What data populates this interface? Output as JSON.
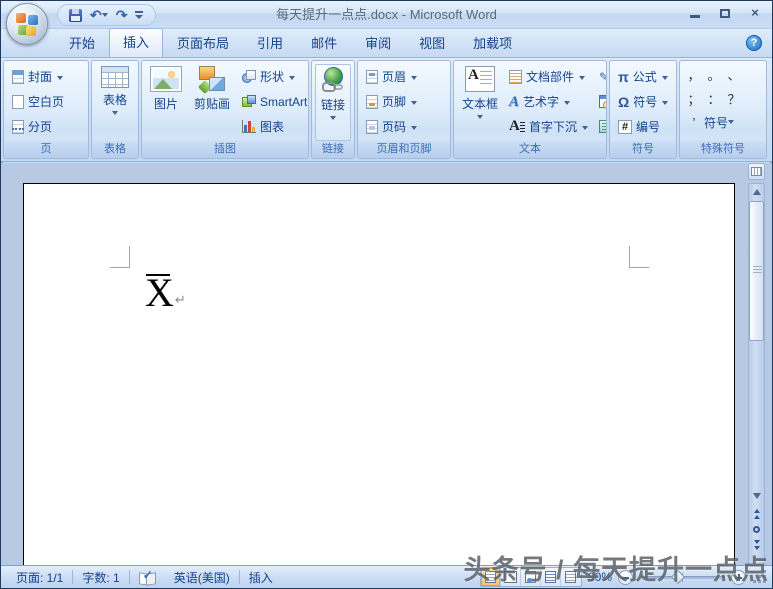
{
  "titlebar": {
    "title": "每天提升一点点.docx - Microsoft Word"
  },
  "icons": {
    "undo": "↶",
    "redo": "↷",
    "close": "×",
    "help": "?",
    "spelling_ok": "✓",
    "signature": "✎",
    "pi": "π",
    "omega": "Ω",
    "textbox_glyph": "A",
    "wordart_glyph": "A",
    "dropcap_glyph": "A",
    "number_glyph": "#"
  },
  "tabs": {
    "home": "开始",
    "insert": "插入",
    "page_layout": "页面布局",
    "references": "引用",
    "mailings": "邮件",
    "review": "审阅",
    "view": "视图",
    "addins": "加载项"
  },
  "ribbon": {
    "pages": {
      "label": "页",
      "cover": "封面",
      "blank": "空白页",
      "break": "分页"
    },
    "tables": {
      "label": "表格",
      "table": "表格"
    },
    "illustrations": {
      "label": "插图",
      "picture": "图片",
      "clipart": "剪贴画",
      "shapes": "形状",
      "smartart": "SmartArt",
      "chart": "图表"
    },
    "links": {
      "label": "链接",
      "link": "链接"
    },
    "header_footer": {
      "label": "页眉和页脚",
      "header": "页眉",
      "footer": "页脚",
      "page_number": "页码"
    },
    "text": {
      "label": "文本",
      "textbox": "文本框",
      "quick_parts": "文档部件",
      "wordart": "艺术字",
      "drop_cap": "首字下沉"
    },
    "symbols": {
      "label": "符号",
      "equation": "公式",
      "symbol": "符号",
      "number": "编号"
    },
    "special": {
      "label": "特殊符号",
      "symbol_button": "符号",
      "glyphs": [
        "，",
        "。",
        "、",
        "；",
        "：",
        "？",
        "’"
      ]
    }
  },
  "document": {
    "content": "X",
    "paragraph_mark": "↵"
  },
  "statusbar": {
    "page": "页面: 1/1",
    "words": "字数: 1",
    "language": "英语(美国)",
    "mode": "插入",
    "zoom_level": "90%"
  },
  "watermark": {
    "text": "头条号 / 每天提升一点点"
  }
}
